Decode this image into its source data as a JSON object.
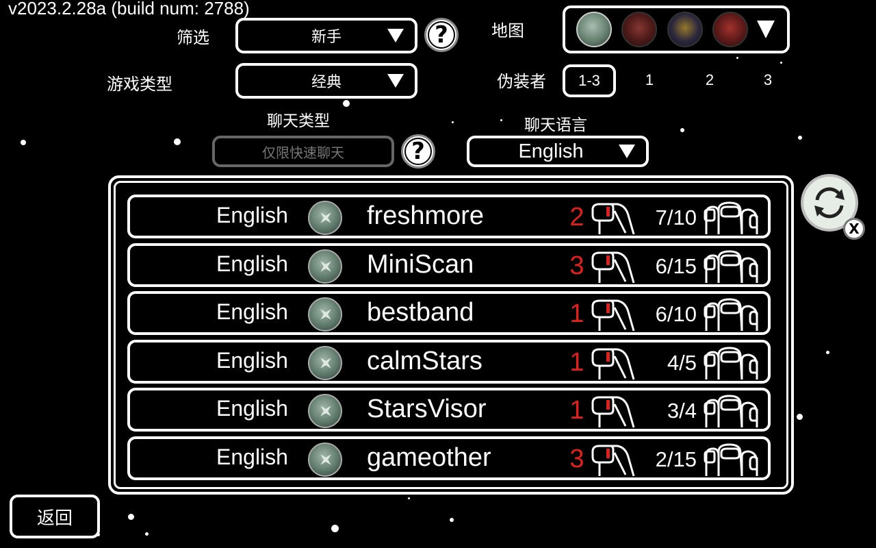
{
  "version": "v2023.2.28a (build num: 2788)",
  "filter": {
    "label": "筛选",
    "value": "新手"
  },
  "game_type": {
    "label": "游戏类型",
    "value": "经典"
  },
  "map": {
    "label": "地图",
    "options": [
      "the-skeld-icon",
      "mira-hq-icon",
      "polus-icon",
      "airship-icon"
    ]
  },
  "impostors": {
    "label": "伪装者",
    "options": [
      "1-3",
      "1",
      "2",
      "3"
    ],
    "selected": "1-3"
  },
  "chat_type": {
    "label": "聊天类型",
    "value": "仅限快速聊天"
  },
  "chat_language": {
    "label": "聊天语言",
    "value": "English"
  },
  "help_symbol": "?",
  "refresh": {
    "close_symbol": "X"
  },
  "back_label": "返回",
  "colors": {
    "impostor_count": "#e0201c",
    "background": "#000000",
    "border": "#ffffff"
  },
  "lobbies": [
    {
      "language": "English",
      "map_icon": "the-skeld-icon",
      "name": "freshmore",
      "impostors": "2",
      "players": "7/10"
    },
    {
      "language": "English",
      "map_icon": "the-skeld-icon",
      "name": "MiniScan",
      "impostors": "3",
      "players": "6/15"
    },
    {
      "language": "English",
      "map_icon": "the-skeld-icon",
      "name": "bestband",
      "impostors": "1",
      "players": "6/10"
    },
    {
      "language": "English",
      "map_icon": "the-skeld-icon",
      "name": "calmStars",
      "impostors": "1",
      "players": "4/5"
    },
    {
      "language": "English",
      "map_icon": "the-skeld-icon",
      "name": "StarsVisor",
      "impostors": "1",
      "players": "3/4"
    },
    {
      "language": "English",
      "map_icon": "the-skeld-icon",
      "name": "gameother",
      "impostors": "3",
      "players": "2/15"
    }
  ]
}
